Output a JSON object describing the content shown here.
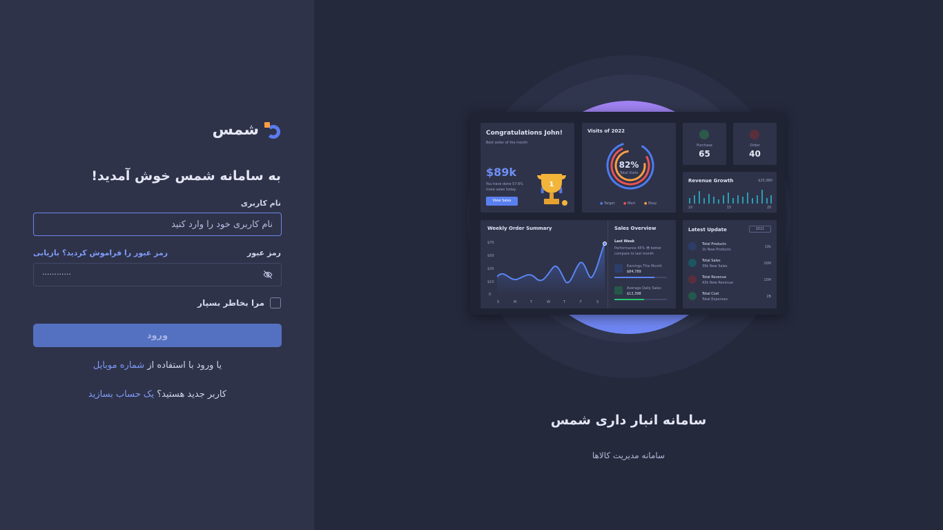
{
  "brand": {
    "name": "شمس"
  },
  "login": {
    "welcome": "به سامانه شمس خوش آمدید!",
    "username_label": "نام کاربری",
    "username_placeholder": "نام کاربری خود را وارد کنید",
    "password_label": "رمز عبور",
    "password_value": "············",
    "forgot_link": "رمز عبور را فراموش کردید؟ بازیابی",
    "remember_label": "مرا بخاطر بسپار",
    "submit_label": "ورود",
    "mobile_prefix": "یا ورود با استفاده از ",
    "mobile_link": "شماره موبایل",
    "signup_prefix": "کاربر جدید هستید؟ ",
    "signup_link": "یک حساب بسازید"
  },
  "hero": {
    "title": "سامانه انبار داری شمس",
    "subtitle": "سامانه مدیریت کالاها"
  },
  "dashboard": {
    "congrats_title": "Congratulations John!",
    "congrats_sub": "Best seller of the month",
    "congrats_amount": "$89k",
    "congrats_desc": "You have done 57.6%",
    "congrats_desc2": "more sales today.",
    "view_sales": "View Sales",
    "visits_title": "Visits of 2022",
    "visits_value": "82%",
    "visits_label": "Total Visits",
    "legend": [
      "Target",
      "Mart",
      "Ebay"
    ],
    "purchase_label": "Purchase",
    "purchase_value": "65",
    "order_label": "Order",
    "order_value": "40",
    "revenue_title": "Revenue Growth",
    "revenue_value": "$25,980",
    "revenue_ticks": [
      "10",
      "15",
      "20"
    ],
    "weekly_title": "Weekly Order Summary",
    "weekly_y": [
      "$70",
      "$50",
      "$30",
      "$10",
      "0"
    ],
    "weekly_x": [
      "S",
      "M",
      "T",
      "W",
      "T",
      "F",
      "S"
    ],
    "sales_title": "Sales Overview",
    "sales_week": "Last Week",
    "sales_perf": "Performance 45% 😎 better",
    "sales_perf2": "compare to last month",
    "earn_label": "Earnings This Month",
    "earn_value": "$84,789",
    "avg_label": "Average Daily Sales",
    "avg_value": "$12,398",
    "latest_title": "Latest Update",
    "latest_year": "2021",
    "latest_rows": [
      {
        "title": "Total Products",
        "sub": "1k New Products",
        "value": "10k"
      },
      {
        "title": "Total Sales",
        "sub": "39k New Sales",
        "value": "26M"
      },
      {
        "title": "Total Revenue",
        "sub": "43k New Revenue",
        "value": "15M"
      },
      {
        "title": "Total Cost",
        "sub": "Total Expenses",
        "value": "2B"
      }
    ]
  },
  "colors": {
    "accent": "#7e9bf9",
    "button": "#5470c0",
    "panel": "#2f3349",
    "background": "#25293c"
  }
}
